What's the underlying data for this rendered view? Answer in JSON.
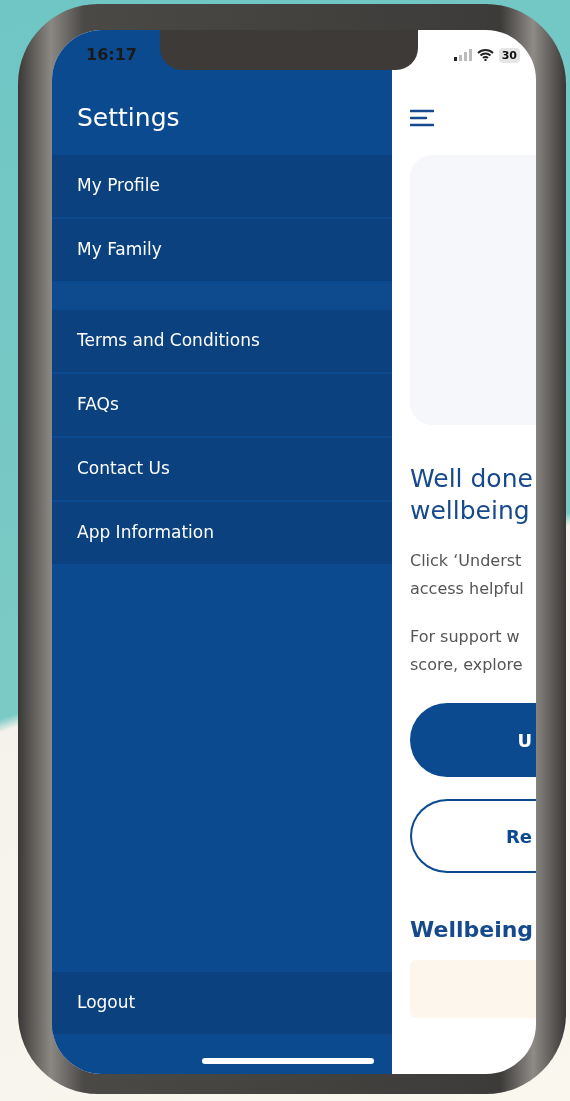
{
  "status_bar": {
    "time": "16:17",
    "battery": "30"
  },
  "drawer": {
    "title": "Settings",
    "groups": [
      [
        {
          "label": "My Profile"
        },
        {
          "label": "My Family"
        }
      ],
      [
        {
          "label": "Terms and Conditions"
        },
        {
          "label": "FAQs"
        },
        {
          "label": "Contact Us"
        },
        {
          "label": "App Information"
        }
      ]
    ],
    "footer_item": {
      "label": "Logout"
    }
  },
  "main": {
    "heading_lines": [
      "Well done",
      "wellbeing"
    ],
    "paragraphs": [
      [
        "Click ‘Underst",
        "access helpful"
      ],
      [
        "For support w",
        "score, explore"
      ]
    ],
    "buttons": [
      {
        "label": "U",
        "kind": "filled"
      },
      {
        "label": "Re",
        "kind": "outline"
      }
    ],
    "section_heading": "Wellbeing"
  }
}
